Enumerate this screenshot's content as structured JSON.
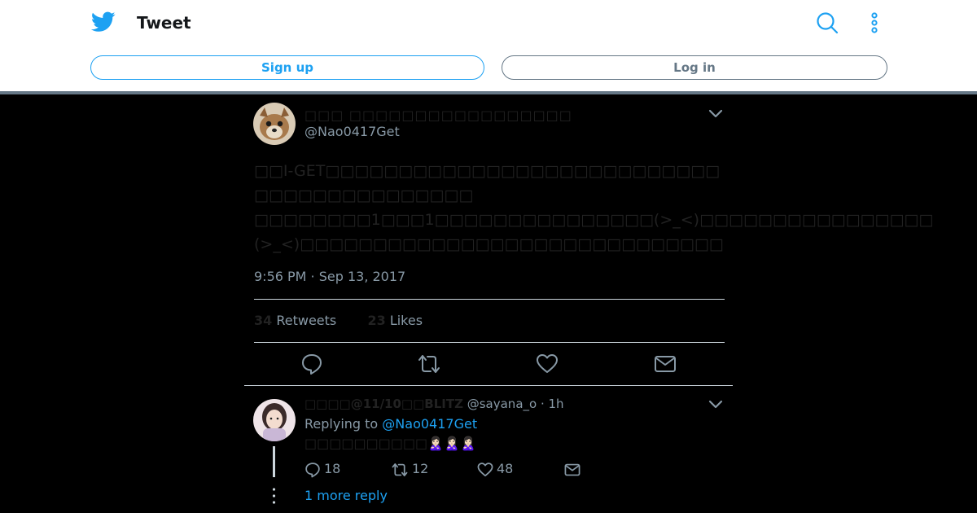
{
  "header": {
    "title": "Tweet",
    "signup_label": "Sign up",
    "login_label": "Log in",
    "icons": [
      "twitter-bird-icon",
      "search-icon",
      "more-vertical-icon"
    ]
  },
  "tweet": {
    "author_name": "□□□ □□□□□□□□□□□□□□□□□",
    "author_handle": "@Nao0417Get",
    "text": "□□I-GET□□□□□□□□□□□□□□□□□□□□□□□□□□□\n□□□□□□□□□□□□□□□\n□□□□□□□□1□□□1□□□□□□□□□□□□□□□(>_<)□□□□□□□□□□□□□□□□\n(>_<)□□□□□□□□□□□□□□□□□□□□□□□□□□□□□",
    "timestamp": "9:56 PM · Sep 13, 2017",
    "retweets_count": "34",
    "retweets_label": "Retweets",
    "likes_count": "23",
    "likes_label": "Likes"
  },
  "reply": {
    "author_name": "□□□□@11/10□□BLITZ",
    "author_handle": "@sayana_o",
    "time": "· 1h",
    "replying_label": "Replying to",
    "replying_handle": "@Nao0417Get",
    "text": "□□□□□□□□□□",
    "emoji": "🙎🏻‍♀️🙎🏻‍♀️🙎🏻‍♀️",
    "reply_count": "18",
    "retweet_count": "12",
    "like_count": "48",
    "more_replies": "1 more reply"
  },
  "colors": {
    "accent": "#1da1f2",
    "muted": "#657786",
    "background": "#000000"
  }
}
